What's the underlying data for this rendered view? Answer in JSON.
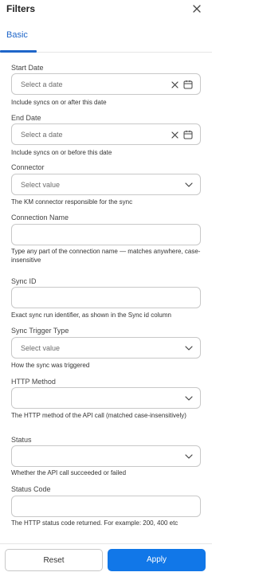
{
  "header": {
    "title": "Filters",
    "close_icon": "close-icon"
  },
  "tabs": [
    {
      "label": "Basic",
      "active": true
    }
  ],
  "accent_color": "#1f66c9",
  "fields": {
    "start_date": {
      "label": "Start Date",
      "placeholder": "Select a date",
      "help": "Include syncs on or after this date"
    },
    "end_date": {
      "label": "End Date",
      "placeholder": "Select a date",
      "help": "Include syncs on or before this date"
    },
    "connector": {
      "label": "Connector",
      "placeholder": "Select value",
      "help": "The KM connector responsible for the sync"
    },
    "connection_name": {
      "label": "Connection Name",
      "value": "",
      "help": "Type any part of the connection name — matches anywhere, case-insensitive"
    },
    "sync_id": {
      "label": "Sync ID",
      "value": "",
      "help": "Exact sync run identifier, as shown in the Sync id column"
    },
    "sync_trigger_type": {
      "label": "Sync Trigger Type",
      "placeholder": "Select value",
      "help": "How the sync was triggered"
    },
    "http_method": {
      "label": "HTTP Method",
      "value": "",
      "help": "The HTTP method of the API call (matched case-insensitively)"
    },
    "status": {
      "label": "Status",
      "value": "",
      "help": "Whether the API call succeeded or failed"
    },
    "status_code": {
      "label": "Status Code",
      "value": "",
      "help": "The HTTP status code returned. For example: 200, 400 etc"
    }
  },
  "footer": {
    "reset_label": "Reset",
    "apply_label": "Apply",
    "apply_color": "#1177e8"
  }
}
